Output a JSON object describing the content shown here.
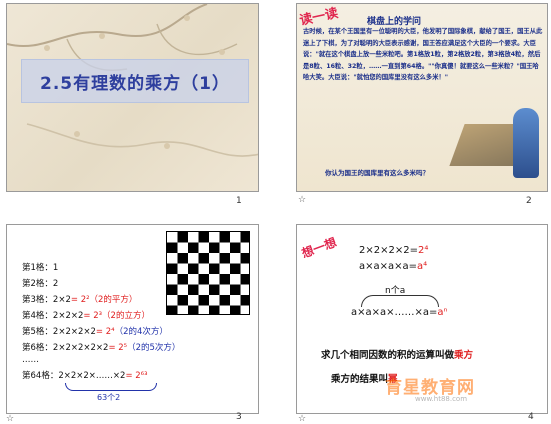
{
  "slides": [
    {
      "number": "1",
      "title": "2.5有理数的乘方（1）"
    },
    {
      "number": "2",
      "tag": "读一读",
      "heading": "棋盘上的学问",
      "story": "古时候，在某个王国里有一位聪明的大臣，他发明了国际象棋，献给了国王，国王从此迷上了下棋，为了对聪明的大臣表示感谢，国王答应满足这个大臣的一个要求。大臣说：\"就在这个棋盘上放一些米粒吧。第1格放1粒，第2格放2粒，第3格放4粒，然后是8粒、16粒、32粒，……一直到第64格。\"\"你真傻！就要这么一些米粒？\"国王哈哈大笑。大臣说：\"就怕您的国库里没有这么多米！\"",
      "question": "你认为国王的国库里有这么多米吗？"
    },
    {
      "number": "3",
      "rows": [
        {
          "label": "第1格：",
          "expr": "1",
          "red": "",
          "note": ""
        },
        {
          "label": "第2格：",
          "expr": "2",
          "red": "",
          "note": ""
        },
        {
          "label": "第3格：",
          "expr": "2×2",
          "red": "= 2²",
          "note": "（2的平方）"
        },
        {
          "label": "第4格：",
          "expr": "2×2×2",
          "red": "= 2³",
          "note": "（2的立方）"
        },
        {
          "label": "第5格：",
          "expr": "2×2×2×2",
          "red": "= 2⁴",
          "note": "（2的4次方）"
        },
        {
          "label": "第6格：",
          "expr": "2×2×2×2×2",
          "red": "= 2⁵",
          "note": "（2的5次方）"
        },
        {
          "label": "……",
          "expr": "",
          "red": "",
          "note": ""
        },
        {
          "label": "第64格：",
          "expr": "2×2×2×……×2",
          "red": "= 2⁶³",
          "note": ""
        }
      ],
      "brace_label": "63个2"
    },
    {
      "number": "4",
      "tag": "想一想",
      "eq1": "2×2×2×2=",
      "eq1_result": "2⁴",
      "eq2": "a×a×a×a=",
      "eq2_result": "a⁴",
      "count_label": "n个a",
      "eq3": "a×a×a×……×a=",
      "eq3_result": "aⁿ",
      "definition_pre": "求几个相同因数的积的运算叫做",
      "definition_key": "乘方",
      "result_pre": "乘方的结果叫",
      "result_key": "幂",
      "watermark": "育星教育网",
      "watermark_url": "www.ht88.com"
    }
  ],
  "colors": {
    "title_blue": "#2e3f9e",
    "story_blue": "#1b2f8a",
    "highlight_red": "#e02020",
    "tag_pink": "#e0264e"
  }
}
